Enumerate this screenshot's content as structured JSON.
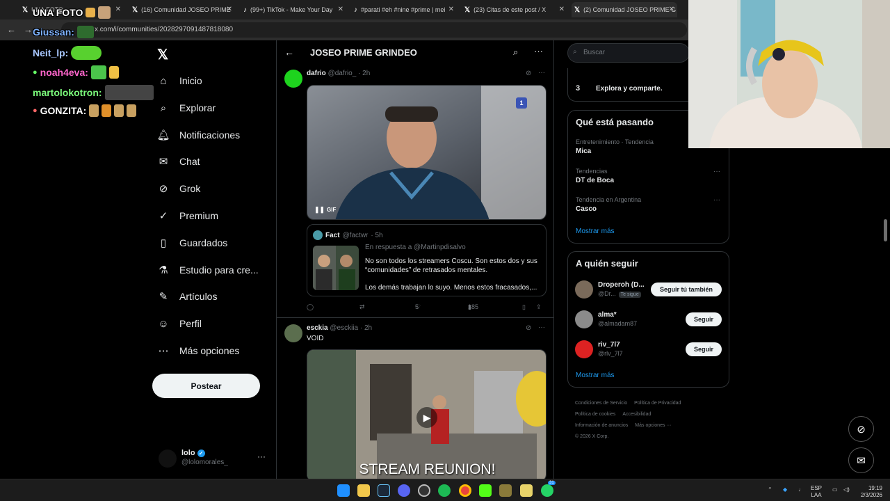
{
  "browser": {
    "tabs": [
      {
        "label": "UNA FOTO",
        "icon": "x-icon",
        "active": false
      },
      {
        "label": "(16) Comunidad JOSEO PRIME",
        "icon": "x-icon",
        "active": false
      },
      {
        "label": "(99+) TikTok - Make Your Day",
        "icon": "tiktok-icon",
        "active": false
      },
      {
        "label": "#parati #eh #nine #prime | mei",
        "icon": "tiktok-icon",
        "active": false
      },
      {
        "label": "(23) Citas de este post / X",
        "icon": "x-icon",
        "active": false
      },
      {
        "label": "(2) Comunidad JOSEO PRIME G",
        "icon": "x-icon",
        "active": true
      }
    ],
    "url": "x.com/i/communities/2028297091487818080"
  },
  "chat_overlay": [
    {
      "user": "UNA FOTO",
      "color": "#ffffff"
    },
    {
      "user": "Giussan:",
      "color": "#7fb3ff"
    },
    {
      "user": "Neit_lp:",
      "color": "#a9c7ff"
    },
    {
      "user": "noah4eva:",
      "color": "#ff66cc"
    },
    {
      "user": "martolokotron:",
      "color": "#7dff7d"
    },
    {
      "user": "GONZITA:",
      "color": "#ffffff"
    }
  ],
  "nav": {
    "items": [
      {
        "label": "Inicio",
        "icon": "home-icon"
      },
      {
        "label": "Explorar",
        "icon": "search-icon"
      },
      {
        "label": "Notificaciones",
        "icon": "bell-icon"
      },
      {
        "label": "Chat",
        "icon": "mail-icon"
      },
      {
        "label": "Grok",
        "icon": "grok-icon"
      },
      {
        "label": "Premium",
        "icon": "premium-icon"
      },
      {
        "label": "Guardados",
        "icon": "bookmark-icon"
      },
      {
        "label": "Estudio para cre...",
        "icon": "flask-icon"
      },
      {
        "label": "Artículos",
        "icon": "article-icon"
      },
      {
        "label": "Perfil",
        "icon": "person-icon"
      },
      {
        "label": "Más opciones",
        "icon": "more-circle-icon"
      }
    ],
    "post_button": "Postear",
    "account": {
      "name": "lolo",
      "handle": "@lolomorales_"
    }
  },
  "community": {
    "title": "JOSEO PRIME GRINDEO"
  },
  "posts": [
    {
      "name": "dafrio",
      "handle": "@dafrio_",
      "time": "· 2h",
      "media_badge": "GIF",
      "media_counter": "1",
      "quote": {
        "name": "Fact",
        "handle": "@factwr",
        "time": "· 5h",
        "reply_to": "En respuesta a @Martinpdisalvo",
        "text1": "No son todos los streamers Coscu. Son estos dos y sus “comunidades” de retrasados mentales.",
        "text2": "Los demás trabajan lo suyo. Menos estos fracasados,..."
      },
      "likes": "5",
      "views": "185"
    },
    {
      "name": "esckia",
      "handle": "@esckiia",
      "time": "· 2h",
      "text": "VOID",
      "video_caption": "STREAM REUNION!"
    }
  ],
  "right": {
    "search_placeholder": "Buscar",
    "steps": [
      {
        "num": "3",
        "text": "Explora y comparte."
      }
    ],
    "trends_title": "Qué está pasando",
    "trends": [
      {
        "meta": "Entretenimiento · Tendencia",
        "name": "Mica"
      },
      {
        "meta": "Tendencias",
        "name": "DT de Boca"
      },
      {
        "meta": "Tendencia en Argentina",
        "name": "Casco"
      }
    ],
    "show_more": "Mostrar más",
    "follow_title": "A quién seguir",
    "follow": [
      {
        "name": "Droperoh (D...",
        "handle": "@Dr...",
        "badge": "Te sigue",
        "button": "Seguir tú también"
      },
      {
        "name": "alma*",
        "handle": "@almadam87",
        "badge": "",
        "button": "Seguir"
      },
      {
        "name": "riv_7l7",
        "handle": "@rlv_7l7",
        "badge": "",
        "button": "Seguir"
      }
    ],
    "show_more2": "Mostrar más",
    "footer": [
      "Condiciones de Servicio",
      "Política de Privacidad",
      "Política de cookies",
      "Accesibilidad",
      "Información de anuncios",
      "Más opciones ···",
      "© 2026 X Corp."
    ]
  },
  "taskbar": {
    "lang": "ESP",
    "lang2": "LAA",
    "time": "19:19",
    "date": "2/3/2026",
    "whatsapp_badge": "31"
  },
  "colors": {
    "accent": "#1d9bf0",
    "background": "#000000"
  }
}
